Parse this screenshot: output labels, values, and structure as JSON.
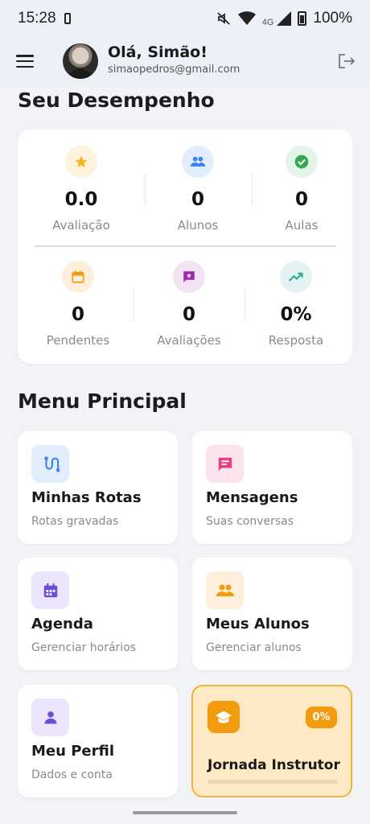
{
  "status": {
    "time": "15:28",
    "network": "4G",
    "battery": "100%"
  },
  "header": {
    "greeting": "Olá, Simão!",
    "email": "simaopedros@gmail.com"
  },
  "performance": {
    "title": "Seu Desempenho",
    "stats": [
      {
        "value": "0.0",
        "label": "Avaliação",
        "icon": "star-icon",
        "color": "#f2b51d",
        "bg": "#fdf3dc"
      },
      {
        "value": "0",
        "label": "Alunos",
        "icon": "people-icon",
        "color": "#3b82f6",
        "bg": "#e3eefd"
      },
      {
        "value": "0",
        "label": "Aulas",
        "icon": "check-circle-icon",
        "color": "#34a853",
        "bg": "#e4f4e8"
      },
      {
        "value": "0",
        "label": "Pendentes",
        "icon": "calendar-icon",
        "color": "#f29b0e",
        "bg": "#fdefdc"
      },
      {
        "value": "0",
        "label": "Avaliações",
        "icon": "review-icon",
        "color": "#9c27b0",
        "bg": "#f3e3f5"
      },
      {
        "value": "0%",
        "label": "Resposta",
        "icon": "trending-up-icon",
        "color": "#26a69a",
        "bg": "#e2f3f1"
      }
    ]
  },
  "menu": {
    "title": "Menu Principal",
    "items": [
      {
        "title": "Minhas Rotas",
        "subtitle": "Rotas gravadas",
        "icon": "route-icon",
        "color": "#3b82f6",
        "bg": "#e3eefd"
      },
      {
        "title": "Mensagens",
        "subtitle": "Suas conversas",
        "icon": "message-icon",
        "color": "#e4407e",
        "bg": "#fce4ee"
      },
      {
        "title": "Agenda",
        "subtitle": "Gerenciar horários",
        "icon": "calendar-icon",
        "color": "#6c4fd6",
        "bg": "#ebe6fb"
      },
      {
        "title": "Meus Alunos",
        "subtitle": "Gerenciar alunos",
        "icon": "people-icon",
        "color": "#f29b0e",
        "bg": "#fdefdc"
      },
      {
        "title": "Meu Perfil",
        "subtitle": "Dados e conta",
        "icon": "person-icon",
        "color": "#6c4fd6",
        "bg": "#ebe6fb"
      }
    ],
    "journey": {
      "title": "Jornada Instrutor",
      "percent_label": "0%",
      "progress": 0,
      "icon": "graduation-cap-icon"
    }
  }
}
